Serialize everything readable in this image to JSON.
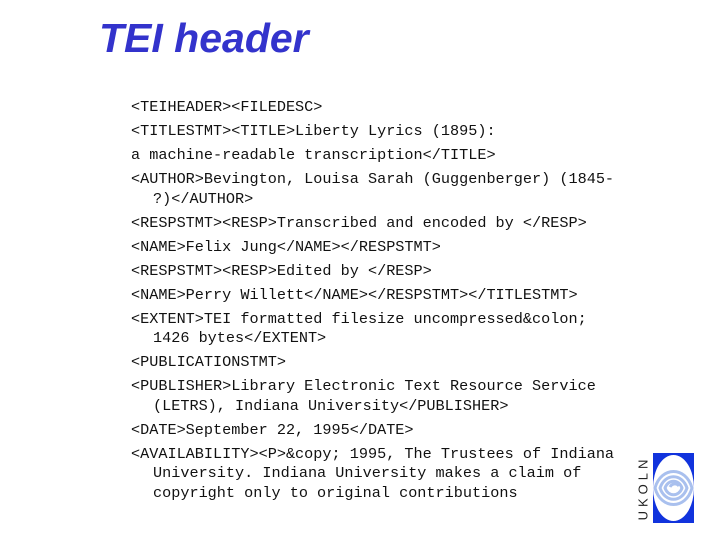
{
  "slide": {
    "title": "TEI header"
  },
  "code": {
    "entries": [
      {
        "lines": [
          "<TEIHEADER><FILEDESC>"
        ]
      },
      {
        "lines": [
          "<TITLESTMT><TITLE>Liberty Lyrics (1895):"
        ]
      },
      {
        "lines": [
          "a machine-readable transcription</TITLE>"
        ]
      },
      {
        "lines": [
          "<AUTHOR>Bevington, Louisa Sarah (Guggenberger) (1845-",
          "?)</AUTHOR>"
        ]
      },
      {
        "lines": [
          "<RESPSTMT><RESP>Transcribed and encoded by </RESP>"
        ]
      },
      {
        "lines": [
          "<NAME>Felix Jung</NAME></RESPSTMT>"
        ]
      },
      {
        "lines": [
          "<RESPSTMT><RESP>Edited by </RESP>"
        ]
      },
      {
        "lines": [
          "<NAME>Perry Willett</NAME></RESPSTMT></TITLESTMT>"
        ]
      },
      {
        "lines": [
          "<EXTENT>TEI formatted filesize uncompressed&colon;",
          "1426 bytes</EXTENT>"
        ]
      },
      {
        "lines": [
          "<PUBLICATIONSTMT>"
        ]
      },
      {
        "lines": [
          "<PUBLISHER>Library Electronic Text Resource Service",
          "(LETRS), Indiana University</PUBLISHER>"
        ]
      },
      {
        "lines": [
          "<DATE>September 22, 1995</DATE>"
        ]
      },
      {
        "lines": [
          "<AVAILABILITY><P>&copy; 1995, The Trustees of Indiana",
          "University. Indiana University makes a claim of",
          "copyright only to original contributions"
        ]
      }
    ]
  },
  "logo": {
    "text": "UKOLN",
    "colors": {
      "background": "#1133dd",
      "outer": "#ffffff",
      "rings": "#a9c0ee",
      "text": "#222222"
    }
  }
}
